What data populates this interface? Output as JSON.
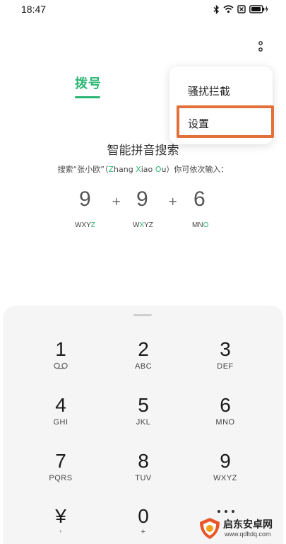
{
  "status_bar": {
    "time": "18:47"
  },
  "tabs": {
    "dial": "拨号"
  },
  "popup_menu": {
    "items": [
      {
        "label": "骚扰拦截"
      },
      {
        "label": "设置"
      }
    ]
  },
  "hint": {
    "title": "智能拼音搜索",
    "desc_prefix": "搜索“张小欧”（",
    "z_hl": "Z",
    "z_rest": "hang ",
    "x_hl": "X",
    "x_rest": "iao ",
    "o_hl": "O",
    "o_rest": "u",
    "desc_suffix": "）你可依次输入：",
    "examples": [
      {
        "digit": "9",
        "letters_before": "WXY",
        "letters_hl": "Z",
        "letters_after": ""
      },
      {
        "digit": "9",
        "letters_before": "W",
        "letters_hl": "X",
        "letters_after": "YZ"
      },
      {
        "digit": "6",
        "letters_before": "MN",
        "letters_hl": "O",
        "letters_after": ""
      }
    ],
    "plus": "+"
  },
  "keypad": {
    "keys": [
      {
        "digit": "1",
        "letters": ""
      },
      {
        "digit": "2",
        "letters": "ABC"
      },
      {
        "digit": "3",
        "letters": "DEF"
      },
      {
        "digit": "4",
        "letters": "GHI"
      },
      {
        "digit": "5",
        "letters": "JKL"
      },
      {
        "digit": "6",
        "letters": "MNO"
      },
      {
        "digit": "7",
        "letters": "PQRS"
      },
      {
        "digit": "8",
        "letters": "TUV"
      },
      {
        "digit": "9",
        "letters": "WXYZ"
      },
      {
        "digit": "¥",
        "letters": ","
      },
      {
        "digit": "0",
        "letters": "+"
      }
    ]
  },
  "watermark": {
    "text": "启东安卓网",
    "url": "www.qdltdq.com"
  },
  "colors": {
    "accent": "#2bb673",
    "highlight_box": "#e2703a",
    "keypad_bg": "#f5f5f5"
  }
}
